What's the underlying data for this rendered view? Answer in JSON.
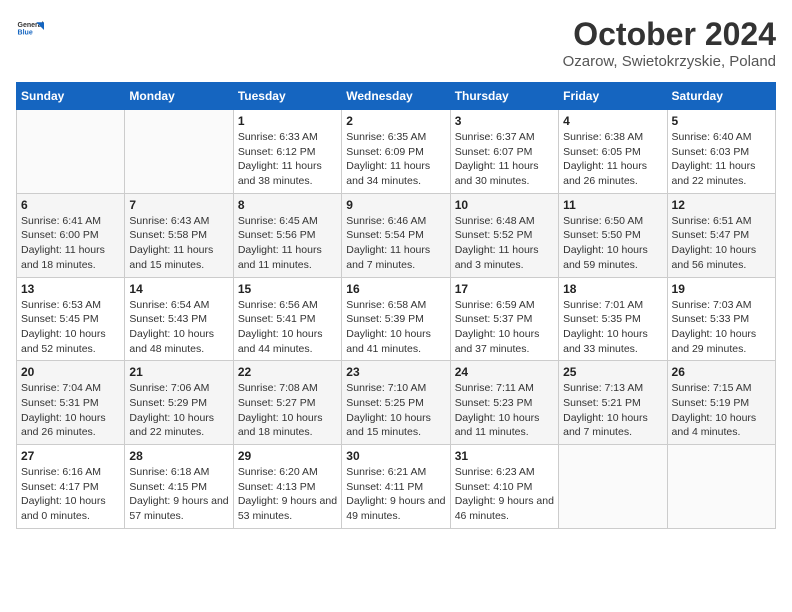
{
  "header": {
    "logo_general": "General",
    "logo_blue": "Blue",
    "month": "October 2024",
    "location": "Ozarow, Swietokrzyskie, Poland"
  },
  "weekdays": [
    "Sunday",
    "Monday",
    "Tuesday",
    "Wednesday",
    "Thursday",
    "Friday",
    "Saturday"
  ],
  "weeks": [
    [
      {
        "day": "",
        "info": ""
      },
      {
        "day": "",
        "info": ""
      },
      {
        "day": "1",
        "info": "Sunrise: 6:33 AM\nSunset: 6:12 PM\nDaylight: 11 hours and 38 minutes."
      },
      {
        "day": "2",
        "info": "Sunrise: 6:35 AM\nSunset: 6:09 PM\nDaylight: 11 hours and 34 minutes."
      },
      {
        "day": "3",
        "info": "Sunrise: 6:37 AM\nSunset: 6:07 PM\nDaylight: 11 hours and 30 minutes."
      },
      {
        "day": "4",
        "info": "Sunrise: 6:38 AM\nSunset: 6:05 PM\nDaylight: 11 hours and 26 minutes."
      },
      {
        "day": "5",
        "info": "Sunrise: 6:40 AM\nSunset: 6:03 PM\nDaylight: 11 hours and 22 minutes."
      }
    ],
    [
      {
        "day": "6",
        "info": "Sunrise: 6:41 AM\nSunset: 6:00 PM\nDaylight: 11 hours and 18 minutes."
      },
      {
        "day": "7",
        "info": "Sunrise: 6:43 AM\nSunset: 5:58 PM\nDaylight: 11 hours and 15 minutes."
      },
      {
        "day": "8",
        "info": "Sunrise: 6:45 AM\nSunset: 5:56 PM\nDaylight: 11 hours and 11 minutes."
      },
      {
        "day": "9",
        "info": "Sunrise: 6:46 AM\nSunset: 5:54 PM\nDaylight: 11 hours and 7 minutes."
      },
      {
        "day": "10",
        "info": "Sunrise: 6:48 AM\nSunset: 5:52 PM\nDaylight: 11 hours and 3 minutes."
      },
      {
        "day": "11",
        "info": "Sunrise: 6:50 AM\nSunset: 5:50 PM\nDaylight: 10 hours and 59 minutes."
      },
      {
        "day": "12",
        "info": "Sunrise: 6:51 AM\nSunset: 5:47 PM\nDaylight: 10 hours and 56 minutes."
      }
    ],
    [
      {
        "day": "13",
        "info": "Sunrise: 6:53 AM\nSunset: 5:45 PM\nDaylight: 10 hours and 52 minutes."
      },
      {
        "day": "14",
        "info": "Sunrise: 6:54 AM\nSunset: 5:43 PM\nDaylight: 10 hours and 48 minutes."
      },
      {
        "day": "15",
        "info": "Sunrise: 6:56 AM\nSunset: 5:41 PM\nDaylight: 10 hours and 44 minutes."
      },
      {
        "day": "16",
        "info": "Sunrise: 6:58 AM\nSunset: 5:39 PM\nDaylight: 10 hours and 41 minutes."
      },
      {
        "day": "17",
        "info": "Sunrise: 6:59 AM\nSunset: 5:37 PM\nDaylight: 10 hours and 37 minutes."
      },
      {
        "day": "18",
        "info": "Sunrise: 7:01 AM\nSunset: 5:35 PM\nDaylight: 10 hours and 33 minutes."
      },
      {
        "day": "19",
        "info": "Sunrise: 7:03 AM\nSunset: 5:33 PM\nDaylight: 10 hours and 29 minutes."
      }
    ],
    [
      {
        "day": "20",
        "info": "Sunrise: 7:04 AM\nSunset: 5:31 PM\nDaylight: 10 hours and 26 minutes."
      },
      {
        "day": "21",
        "info": "Sunrise: 7:06 AM\nSunset: 5:29 PM\nDaylight: 10 hours and 22 minutes."
      },
      {
        "day": "22",
        "info": "Sunrise: 7:08 AM\nSunset: 5:27 PM\nDaylight: 10 hours and 18 minutes."
      },
      {
        "day": "23",
        "info": "Sunrise: 7:10 AM\nSunset: 5:25 PM\nDaylight: 10 hours and 15 minutes."
      },
      {
        "day": "24",
        "info": "Sunrise: 7:11 AM\nSunset: 5:23 PM\nDaylight: 10 hours and 11 minutes."
      },
      {
        "day": "25",
        "info": "Sunrise: 7:13 AM\nSunset: 5:21 PM\nDaylight: 10 hours and 7 minutes."
      },
      {
        "day": "26",
        "info": "Sunrise: 7:15 AM\nSunset: 5:19 PM\nDaylight: 10 hours and 4 minutes."
      }
    ],
    [
      {
        "day": "27",
        "info": "Sunrise: 6:16 AM\nSunset: 4:17 PM\nDaylight: 10 hours and 0 minutes."
      },
      {
        "day": "28",
        "info": "Sunrise: 6:18 AM\nSunset: 4:15 PM\nDaylight: 9 hours and 57 minutes."
      },
      {
        "day": "29",
        "info": "Sunrise: 6:20 AM\nSunset: 4:13 PM\nDaylight: 9 hours and 53 minutes."
      },
      {
        "day": "30",
        "info": "Sunrise: 6:21 AM\nSunset: 4:11 PM\nDaylight: 9 hours and 49 minutes."
      },
      {
        "day": "31",
        "info": "Sunrise: 6:23 AM\nSunset: 4:10 PM\nDaylight: 9 hours and 46 minutes."
      },
      {
        "day": "",
        "info": ""
      },
      {
        "day": "",
        "info": ""
      }
    ]
  ]
}
